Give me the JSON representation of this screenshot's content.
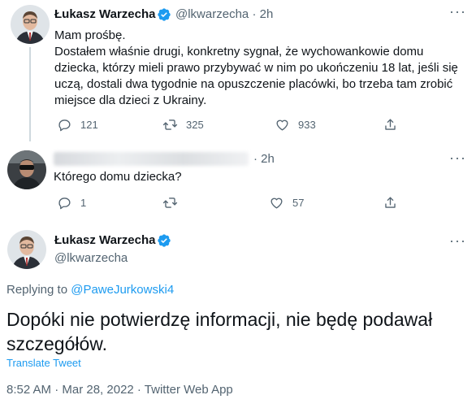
{
  "tweet1": {
    "author": "Łukasz Warzecha",
    "handle": "@lkwarzecha",
    "separator": "·",
    "time": "2h",
    "line1": "Mam prośbę.",
    "line2": "Dostałem właśnie drugi, konkretny sygnał, że wychowankowie domu dziecka, którzy mieli prawo przybywać w nim po ukończeniu 18 lat, jeśli się uczą, dostali dwa tygodnie na opuszczenie placówki, bo trzeba tam zrobić miejsce dla dzieci z Ukrainy.",
    "replies": "121",
    "retweets": "325",
    "likes": "933"
  },
  "tweet2": {
    "separator": "·",
    "time": "2h",
    "text": "Którego domu dziecka?",
    "replies": "1",
    "retweets": "",
    "likes": "57"
  },
  "main": {
    "author": "Łukasz Warzecha",
    "handle": "@lkwarzecha",
    "replying_prefix": "Replying to ",
    "replying_to": "@PaweJurkowski4",
    "text": "Dopóki nie potwierdzę informacji, nie będę podawał szczegółów.",
    "translate": "Translate Tweet",
    "timestamp": "8:52 AM · Mar 28, 2022 · Twitter Web App"
  },
  "icons": {
    "more": "more-horizontal-icon",
    "reply": "reply-icon",
    "retweet": "retweet-icon",
    "like": "heart-icon",
    "share": "share-icon",
    "verified": "verified-badge-icon"
  },
  "colors": {
    "accent": "#1d9bf0",
    "muted": "#536471",
    "text": "#0f1419",
    "line": "#cfd9de"
  }
}
